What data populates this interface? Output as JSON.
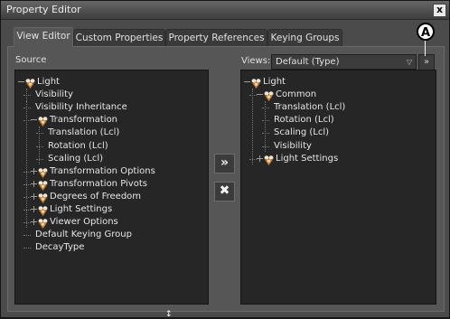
{
  "window": {
    "title": "Property Editor",
    "close_glyph": "x"
  },
  "tabs": [
    {
      "label": "View Editor",
      "active": true
    },
    {
      "label": "Custom Properties",
      "active": false
    },
    {
      "label": "Property References",
      "active": false
    },
    {
      "label": "Keying Groups",
      "active": false
    }
  ],
  "source": {
    "label": "Source",
    "items": [
      {
        "label": "Light",
        "icon": true,
        "expand": "minus"
      },
      {
        "label": "Visibility"
      },
      {
        "label": "Visibility Inheritance"
      },
      {
        "label": "Transformation",
        "icon": true,
        "expand": "minus"
      },
      {
        "label": "Translation (Lcl)"
      },
      {
        "label": "Rotation (Lcl)"
      },
      {
        "label": "Scaling (Lcl)"
      },
      {
        "label": "Transformation Options",
        "icon": true,
        "expand": "plus"
      },
      {
        "label": "Transformation Pivots",
        "icon": true,
        "expand": "plus"
      },
      {
        "label": "Degrees of Freedom",
        "icon": true,
        "expand": "plus"
      },
      {
        "label": "Light Settings",
        "icon": true,
        "expand": "plus"
      },
      {
        "label": "Viewer Options",
        "icon": true,
        "expand": "plus"
      },
      {
        "label": "Default Keying Group"
      },
      {
        "label": "DecayType"
      }
    ]
  },
  "views": {
    "label": "Views:",
    "selected": "Default (Type)",
    "dropdown_arrow": "▽",
    "button_glyph": "»",
    "items": [
      {
        "label": "Light",
        "icon": true,
        "expand": "minus"
      },
      {
        "label": "Common",
        "icon": true,
        "expand": "minus"
      },
      {
        "label": "Translation (Lcl)"
      },
      {
        "label": "Rotation (Lcl)"
      },
      {
        "label": "Scaling (Lcl)"
      },
      {
        "label": "Visibility"
      },
      {
        "label": "Light Settings",
        "icon": true,
        "expand": "plus"
      }
    ]
  },
  "buttons": {
    "add_glyph": "»",
    "remove_glyph": "✖"
  },
  "callout": {
    "letter": "A"
  },
  "resize_glyph": "↕",
  "colors": {
    "background": "#4b4b4b",
    "list_bg": "#262626",
    "text": "#e6e6e6",
    "icon": "#c98a4a"
  }
}
